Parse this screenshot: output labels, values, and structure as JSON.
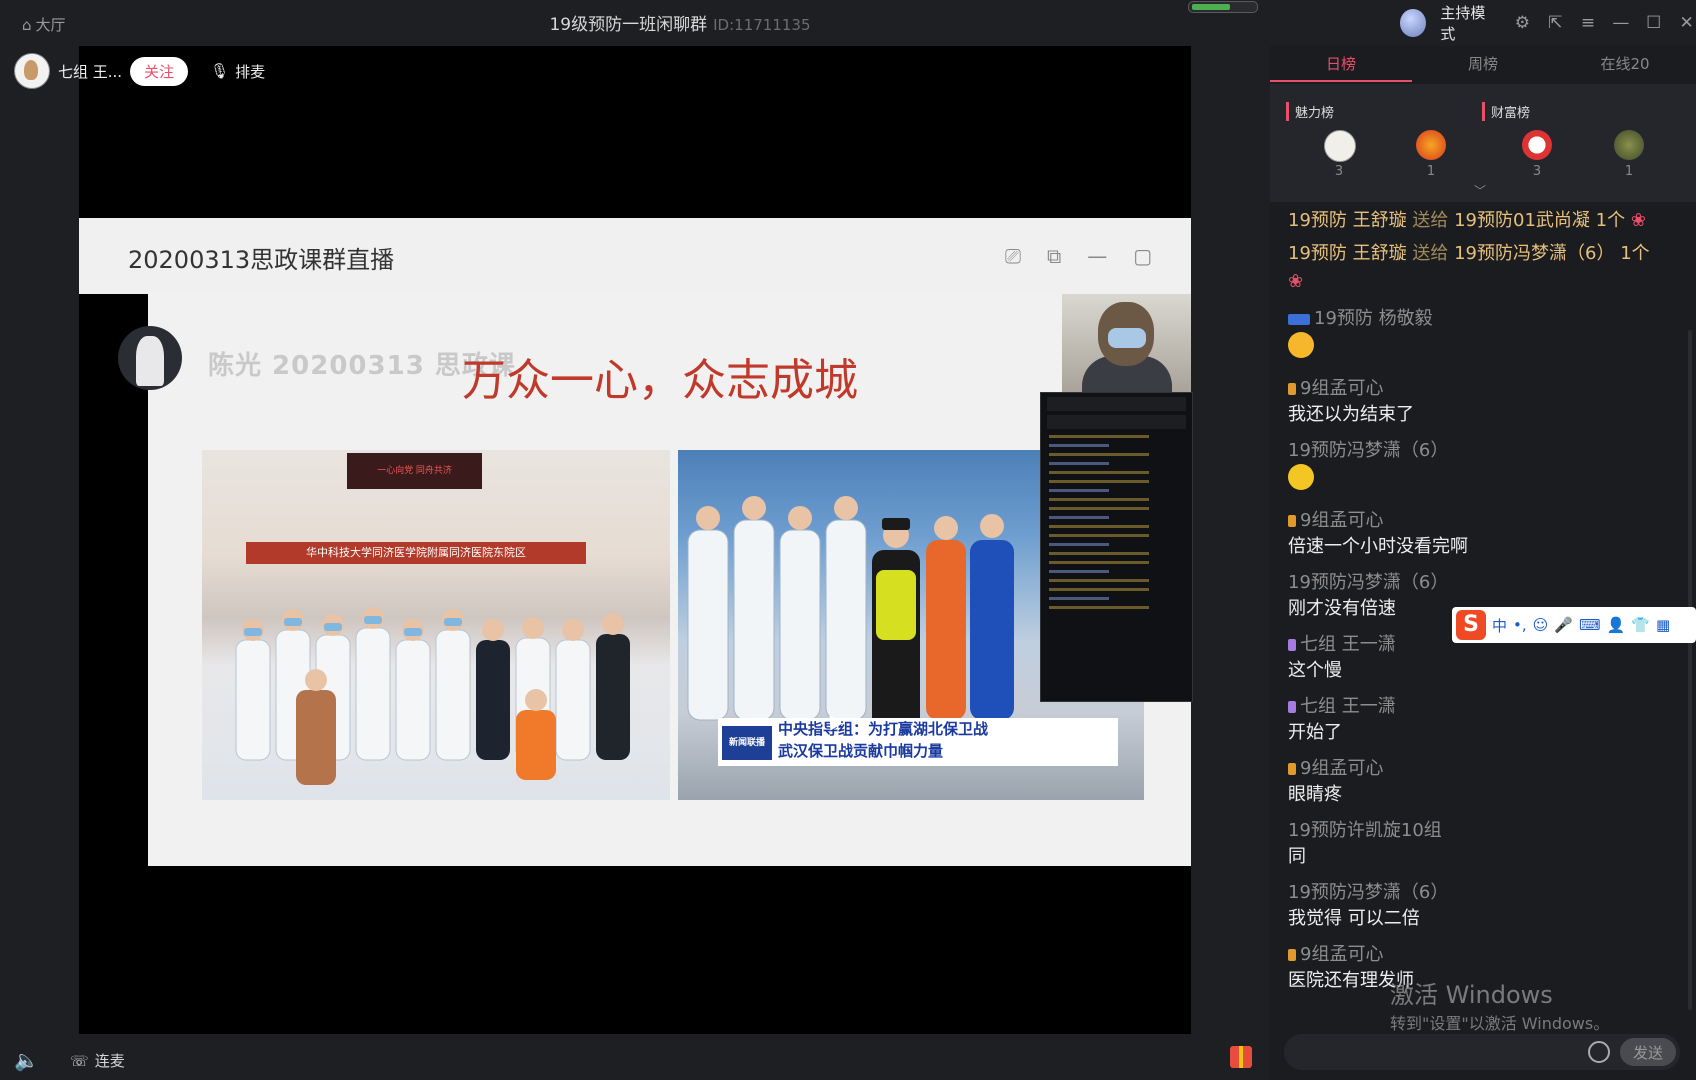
{
  "titlebar": {
    "home_label": "大厅",
    "room_title": "19级预防一班闲聊群",
    "room_id": "ID:11711135",
    "mode_label": "主持模式"
  },
  "host": {
    "name": "七组 王...",
    "follow_label": "关注",
    "queue_label": "排麦"
  },
  "slide": {
    "title": "20200313思政课群直播",
    "ghost_text": "陈光 20200313 思政课",
    "slogan": "万众一心，众志成城",
    "caption_line1": "中央指导组：为打赢湖北保卫战",
    "caption_line2": "武汉保卫战贡献巾帼力量",
    "caption_logo": "新闻联播",
    "photo1_sign": "华中科技大学同济医学院附属同济医院东院区",
    "photo1_banner": "一心向党 同舟共济"
  },
  "bottom": {
    "lianmai_label": "连麦"
  },
  "panel": {
    "tabs": [
      "日榜",
      "周榜",
      "在线20"
    ],
    "active_tab": "日榜",
    "rank_titles": [
      "魅力榜",
      "财富榜"
    ],
    "rank_counts": [
      "3",
      "1",
      "3",
      "1"
    ],
    "chat": [
      {
        "type": "gift",
        "from": "19预防 王舒璇",
        "verb": "送给",
        "to": "19预防01武尚凝",
        "amount": "1个"
      },
      {
        "type": "gift",
        "from": "19预防 王舒璇",
        "verb": "送给",
        "to": "19预防冯梦潇（6）",
        "amount": "1个"
      },
      {
        "type": "msg",
        "who": "19预防 杨敬毅",
        "text": ""
      },
      {
        "type": "msg",
        "who": "9组孟可心",
        "text": "我还以为结束了"
      },
      {
        "type": "msg",
        "who": "19预防冯梦潇（6）",
        "text": ""
      },
      {
        "type": "msg",
        "who": "9组孟可心",
        "text": "倍速一个小时没看完啊"
      },
      {
        "type": "msg",
        "who": "19预防冯梦潇（6）",
        "text": "刚才没有倍速"
      },
      {
        "type": "msg",
        "who": "七组 王一潇",
        "text": "这个慢"
      },
      {
        "type": "msg",
        "who": "七组 王一潇",
        "text": "开始了"
      },
      {
        "type": "msg",
        "who": "9组孟可心",
        "text": "眼睛疼"
      },
      {
        "type": "msg",
        "who": "19预防许凯旋10组",
        "text": "同"
      },
      {
        "type": "msg",
        "who": "19预防冯梦潇（6）",
        "text": "我觉得 可以二倍"
      },
      {
        "type": "msg",
        "who": "9组孟可心",
        "text": "医院还有理发师"
      }
    ],
    "send_label": "发送",
    "ime_label": "中"
  },
  "watermark": {
    "line1": "激活 Windows",
    "line2": "转到\"设置\"以激活 Windows。"
  },
  "colors": {
    "accent": "#e8506a",
    "gift_text": "#e6c07a",
    "bg": "#1e1f23"
  }
}
